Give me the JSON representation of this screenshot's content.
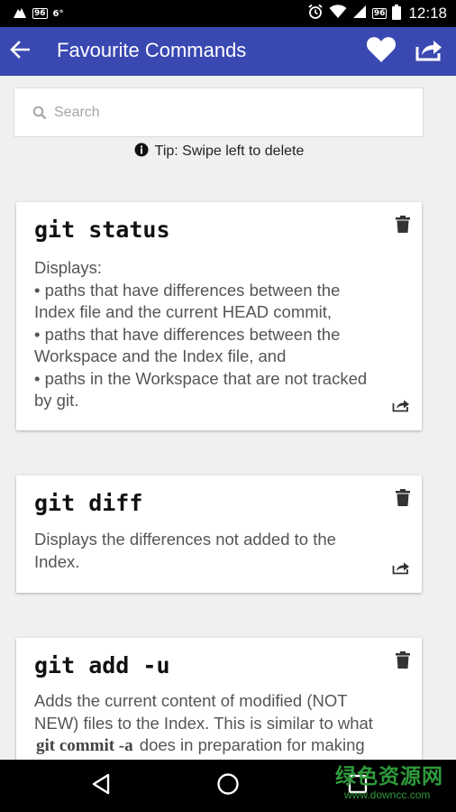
{
  "status_bar": {
    "network_badge": "96",
    "degree_label": "6°",
    "battery_level": "96",
    "clock": "12:18"
  },
  "app_bar": {
    "title": "Favourite Commands"
  },
  "search": {
    "placeholder": "Search",
    "value": ""
  },
  "tip": {
    "text": "Tip: Swipe left to delete"
  },
  "commands": [
    {
      "name": "git status",
      "lines": [
        "Displays:",
        "• paths that have differences between the",
        "Index file and the current HEAD commit,",
        "• paths that have differences between the",
        "Workspace and the Index file, and",
        "• paths in the Workspace that are not tracked",
        "by git."
      ]
    },
    {
      "name": "git diff",
      "lines": [
        "Displays the differences not added to the",
        "Index."
      ]
    },
    {
      "name": "git add -u",
      "lines": [
        "Adds the current content of modified (NOT",
        "NEW) files to the Index. This is similar to what"
      ],
      "line3_code": "git commit -a",
      "line3_rest": "does in preparation for making"
    }
  ],
  "watermark": {
    "main": "绿色资源网",
    "sub": "www.downcc.com"
  },
  "colors": {
    "app_bar": "#3a48b2",
    "background": "#f0f0f0",
    "card": "#ffffff"
  }
}
